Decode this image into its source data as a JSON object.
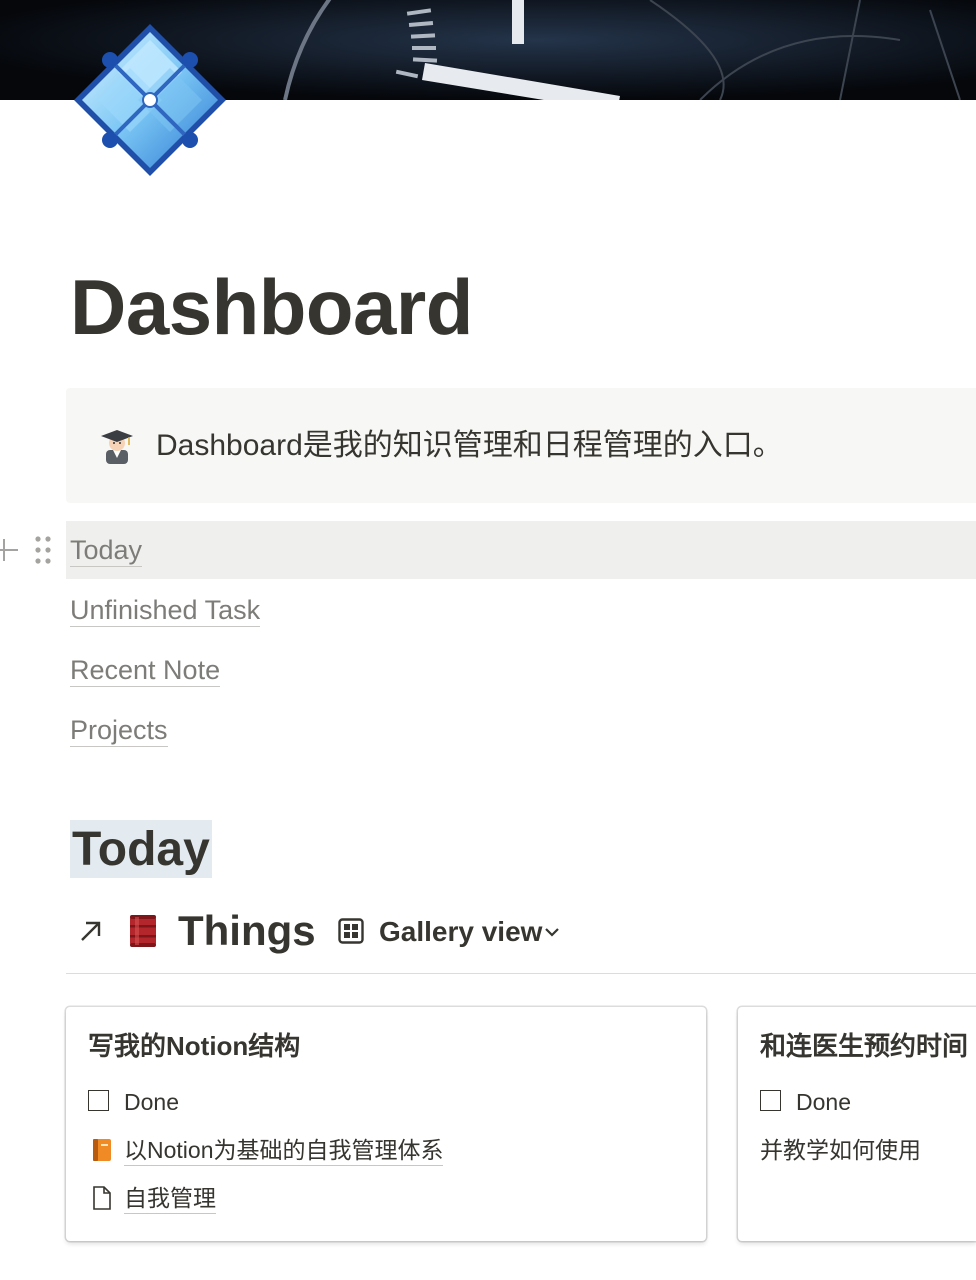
{
  "page": {
    "title": "Dashboard",
    "icon": "diamond-grid-icon",
    "cover": "dark-dashboard-gauge-image"
  },
  "callout": {
    "emoji": "student-emoji",
    "text": "Dashboard是我的知识管理和日程管理的入口。"
  },
  "links": [
    {
      "label": "Today"
    },
    {
      "label": "Unfinished Task"
    },
    {
      "label": "Recent Note"
    },
    {
      "label": "Projects"
    }
  ],
  "section": {
    "heading": "Today"
  },
  "database": {
    "title": "Things",
    "link_icon": "arrow-up-right-icon",
    "emoji": "oil-barrel-icon",
    "view_label": "Gallery view",
    "view_icon": "gallery-grid-icon"
  },
  "cards": [
    {
      "title": "写我的Notion结构",
      "done_label": "Done",
      "rows": [
        {
          "icon": "orange-book-icon",
          "text": "以Notion为基础的自我管理体系"
        },
        {
          "icon": "page-icon",
          "text": "自我管理"
        }
      ]
    },
    {
      "title": "和连医生预约时间",
      "done_label": "Done",
      "text": "并教学如何使用"
    }
  ],
  "colors": {
    "text": "#37352f",
    "link_text": "#7d7c78",
    "callout_bg": "#f7f7f5",
    "hover_bg": "#efefee",
    "heading_highlight": "#e3ebf1"
  }
}
